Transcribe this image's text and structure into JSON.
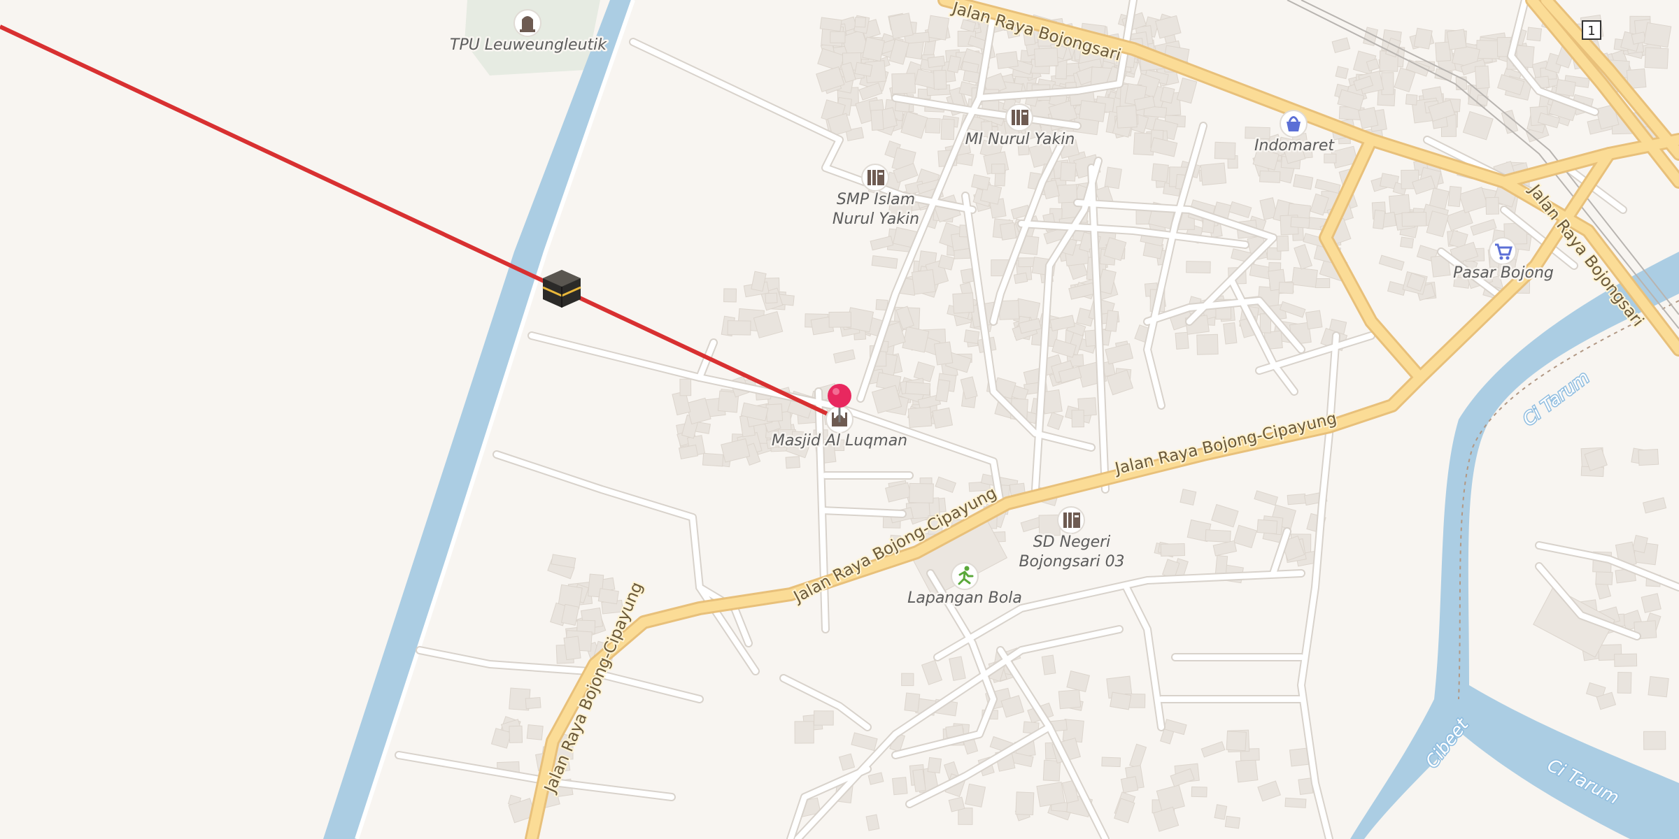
{
  "map": {
    "colors": {
      "land": "#f8f5f1",
      "water": "#abcde3",
      "major_road": "#fbdc96",
      "major_road_casing": "#e8c07a",
      "minor_road": "#ffffff",
      "building": "#e9e4de",
      "cemetery": "#e6ebe2",
      "qibla_line": "#d83031",
      "pin": "#e8285f"
    },
    "pois": {
      "cemetery": {
        "label": "TPU Leuweungleutik",
        "icon": "grave-icon"
      },
      "mi_school": {
        "label": "MI Nurul Yakin",
        "icon": "school-icon"
      },
      "smp_school": {
        "label_line1": "SMP Islam",
        "label_line2": "Nurul Yakin",
        "icon": "school-icon"
      },
      "indomaret": {
        "label": "Indomaret",
        "icon": "shopping-basket-icon"
      },
      "market": {
        "label": "Pasar Bojong",
        "icon": "shopping-cart-icon"
      },
      "mosque": {
        "label": "Masjid Al Luqman",
        "icon": "mosque-icon"
      },
      "sd_school": {
        "label_line1": "SD Negeri",
        "label_line2": "Bojongsari 03",
        "icon": "school-icon"
      },
      "field": {
        "label": "Lapangan Bola",
        "icon": "running-person-icon"
      }
    },
    "roads": {
      "north_road": "Jalan Raya Bojongsari",
      "northeast_road": "Jalan Raya Bojongsari",
      "cipayung_east": "Jalan Raya Bojong-Cipayung",
      "cipayung_mid": "Jalan Raya Bojong-Cipayung",
      "cipayung_west": "Jalan Raya Bojong-Cipayung"
    },
    "water": {
      "river_east": "Ci Tarum",
      "river_south": "Ci Tarum",
      "river_branch": "Cibeet"
    },
    "route_shield": "1",
    "kaaba_icon": "kaaba-icon",
    "pin_icon": "location-pin-icon"
  }
}
